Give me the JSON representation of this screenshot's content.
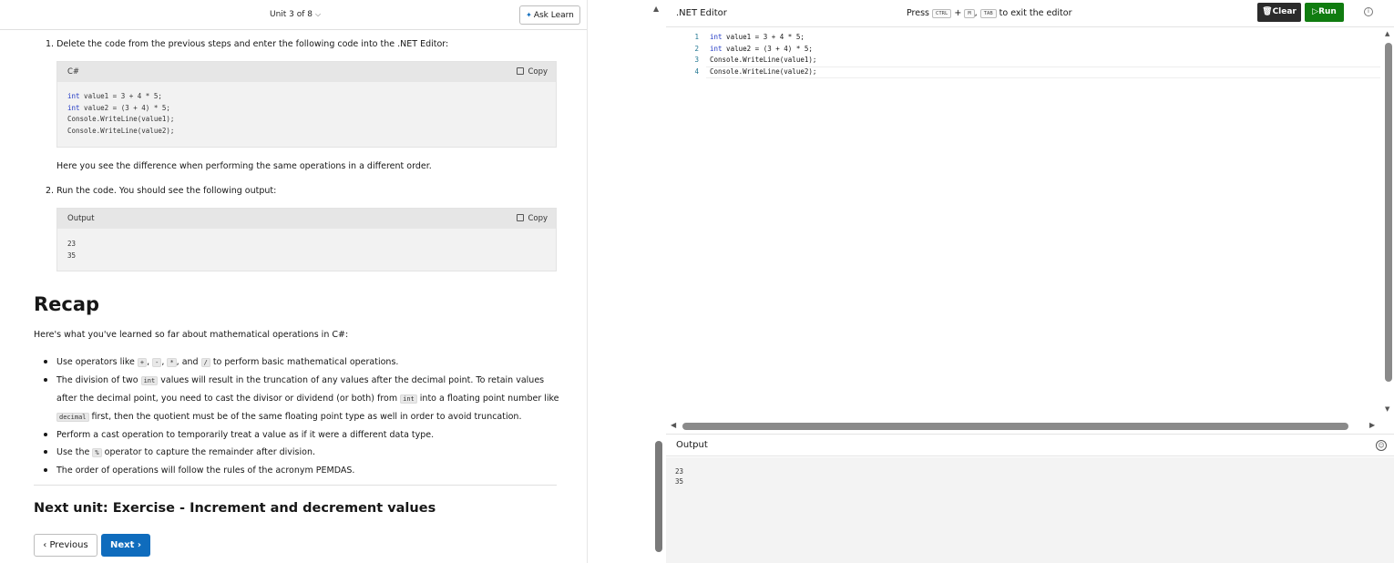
{
  "learn": {
    "unit_selector": "Unit 3 of 8",
    "ask_learn": "Ask Learn",
    "step1_number": "1.",
    "step1_text": "Delete the code from the previous steps and enter the following code into the .NET Editor:",
    "code_block": {
      "language": "C#",
      "copy": "Copy",
      "lines": [
        {
          "kw": "int",
          "rest": " value1 = 3 + 4 * 5;"
        },
        {
          "kw": "int",
          "rest": " value2 = (3 + 4) * 5;"
        },
        {
          "kw": "",
          "rest": "Console.WriteLine(value1);"
        },
        {
          "kw": "",
          "rest": "Console.WriteLine(value2);"
        }
      ]
    },
    "diff_text": "Here you see the difference when performing the same operations in a different order.",
    "step2_number": "2.",
    "step2_text": "Run the code. You should see the following output:",
    "output_block": {
      "label": "Output",
      "copy": "Copy",
      "lines": [
        "23",
        "35"
      ]
    },
    "recap_heading": "Recap",
    "recap_intro": "Here's what you've learned so far about mathematical operations in C#:",
    "bullets": {
      "b1_pre": "Use operators like ",
      "op_plus": "+",
      "comma1": ", ",
      "op_minus": "-",
      "comma2": ", ",
      "op_star": "*",
      "and_txt": ", and ",
      "op_slash": "/",
      "b1_post": " to perform basic mathematical operations.",
      "b2_pre": "The division of two ",
      "b2_int1": "int",
      "b2_mid1": " values will result in the truncation of any values after the decimal point. To retain values after the decimal point, you need to cast the divisor or dividend (or both) from ",
      "b2_int2": "int",
      "b2_mid2": " into a floating point number like ",
      "b2_decimal": "decimal",
      "b2_post": " first, then the quotient must be of the same floating point type as well in order to avoid truncation.",
      "b3": "Perform a cast operation to temporarily treat a value as if it were a different data type.",
      "b4_pre": "Use the ",
      "b4_op": "%",
      "b4_post": " operator to capture the remainder after division.",
      "b5": "The order of operations will follow the rules of the acronym PEMDAS."
    },
    "next_unit_heading": "Next unit: Exercise - Increment and decrement values",
    "previous_label": "Previous",
    "next_label": "Next"
  },
  "editor": {
    "title": ".NET Editor",
    "press": "Press",
    "key_ctrl": "CTRL",
    "plus": "+",
    "key_m": "M",
    "comma": ",",
    "key_tab": "TAB",
    "exit_text": "to exit the editor",
    "clear_label": "Clear",
    "run_label": "Run",
    "line_numbers": [
      "1",
      "2",
      "3",
      "4"
    ],
    "code_lines": [
      {
        "kw": "int",
        "rest": " value1 = 3 + 4 * 5;"
      },
      {
        "kw": "int",
        "rest": " value2 = (3 + 4) * 5;"
      },
      {
        "kw": "",
        "rest": "Console.WriteLine(value1);"
      },
      {
        "kw": "",
        "rest": "Console.WriteLine(value2);"
      }
    ]
  },
  "output": {
    "title": "Output",
    "lines": [
      "23",
      "35"
    ]
  }
}
